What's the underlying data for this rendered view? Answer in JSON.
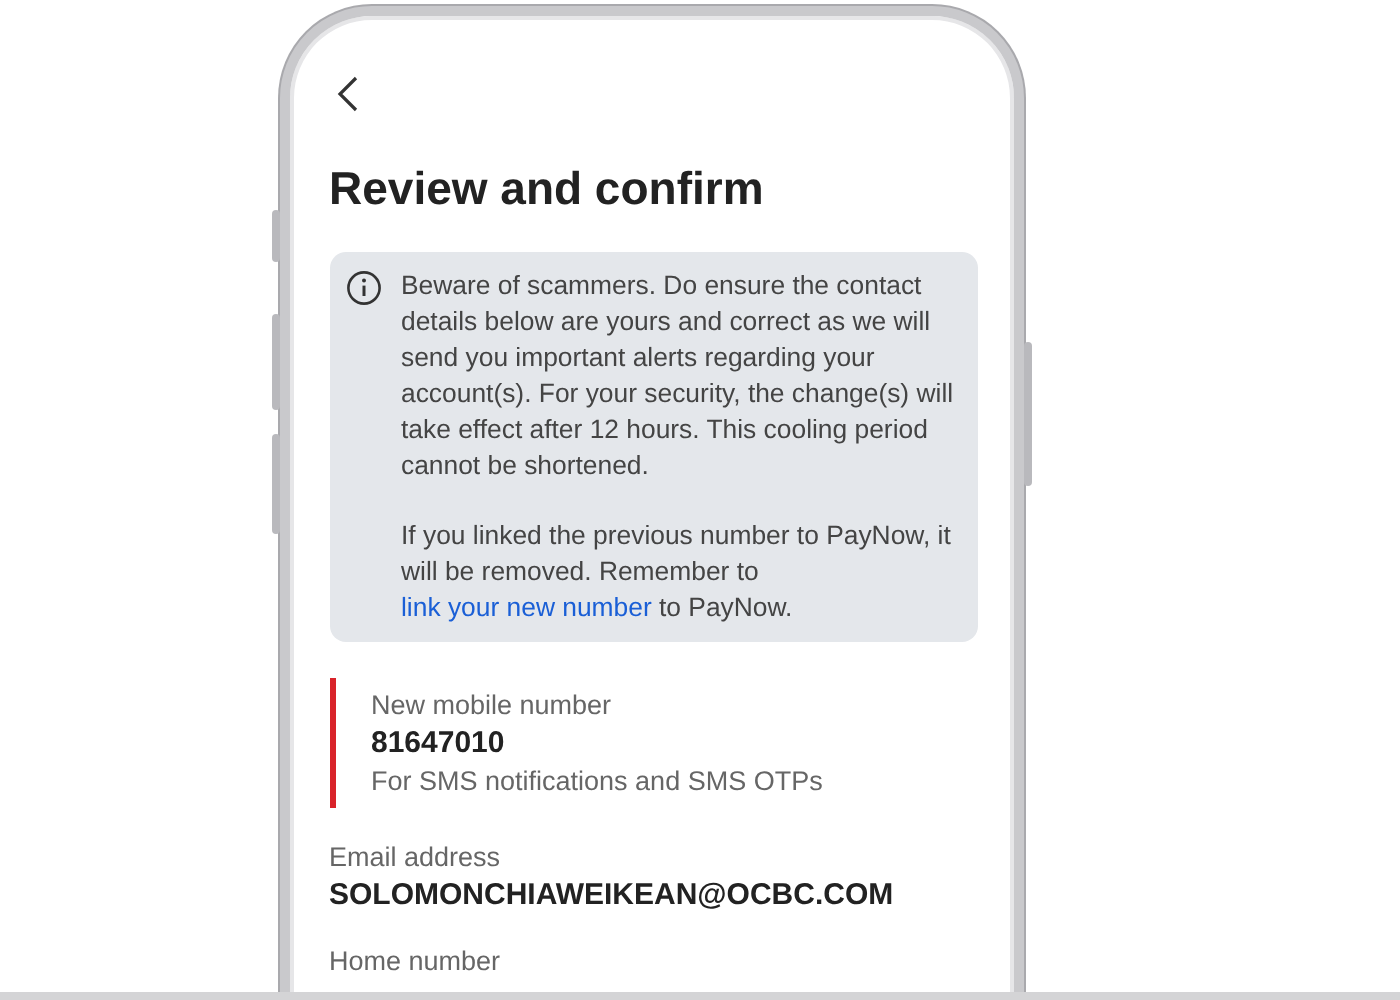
{
  "title": "Review and confirm",
  "notice": {
    "text": "Beware of scammers. Do ensure the contact details below are yours and correct as we will send you important alerts regarding your account(s). For your security, the change(s) will take effect after 12 hours. This cooling period cannot be shortened.",
    "before_link": "If you linked the previous number to PayNow, it will be removed. Remember to",
    "link": "link your new number",
    "after_link": "to PayNow."
  },
  "details": [
    {
      "label": "New mobile number",
      "value": "81647010",
      "note": "For SMS notifications and SMS OTPs",
      "highlighted": true
    },
    {
      "label": "Email address",
      "value": "SOLOMONCHIAWEIKEAN@OCBC.COM",
      "highlighted": false
    },
    {
      "label": "Home number",
      "highlighted": false
    }
  ]
}
